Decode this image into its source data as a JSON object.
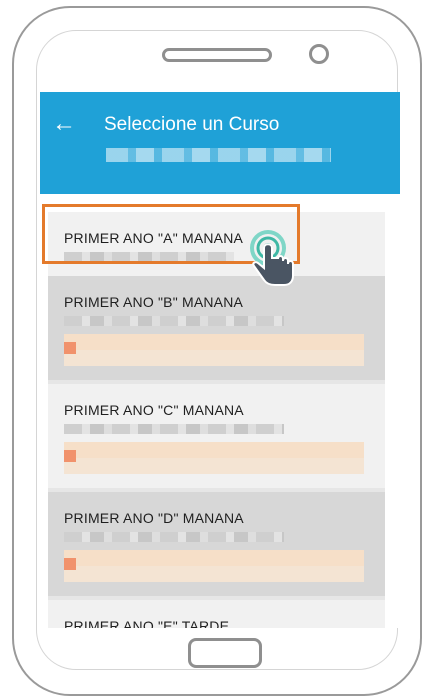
{
  "header": {
    "title": "Seleccione un Curso",
    "back_icon": "arrow-left-icon"
  },
  "courses": [
    {
      "name": "PRIMER ANO \"A\" MANANA"
    },
    {
      "name": "PRIMER ANO \"B\" MANANA"
    },
    {
      "name": "PRIMER ANO \"C\" MANANA"
    },
    {
      "name": "PRIMER ANO \"D\" MANANA"
    },
    {
      "name": "PRIMER ANO \"E\" TARDE"
    }
  ],
  "highlighted_index": 0,
  "colors": {
    "app_bar": "#1fa1d7",
    "highlight": "#e47a2b"
  },
  "tap_indicator_icon": "hand-tap-icon"
}
